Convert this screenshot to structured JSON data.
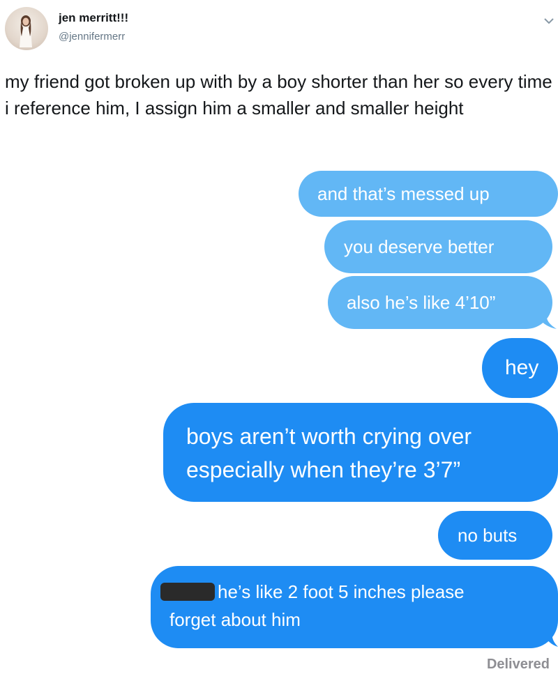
{
  "tweet": {
    "display_name": "jen merritt!!!",
    "handle": "@jennifermerr",
    "text": "my friend got broken up with by a boy shorter than her so every time i reference him, I assign him a smaller and smaller height"
  },
  "messages": [
    {
      "text": "and that’s messed up",
      "style": "light"
    },
    {
      "text": "you deserve better",
      "style": "light"
    },
    {
      "text": "also he’s like 4’10”",
      "style": "light"
    },
    {
      "text": "hey",
      "style": "dark"
    },
    {
      "lines": [
        "boys aren’t worth crying over",
        "especially when they’re 3’7”"
      ],
      "style": "dark"
    },
    {
      "text": "no buts",
      "style": "dark"
    },
    {
      "lines": [
        "he’s like 2 foot 5 inches please",
        "forget about him"
      ],
      "style": "dark",
      "redacted_prefix": true
    }
  ],
  "status": "Delivered",
  "colors": {
    "light_bubble": "#62b7f5",
    "dark_bubble": "#1e8cf3",
    "text": "#14171a",
    "handle": "#657786"
  },
  "icons": [
    "chevron-down-icon"
  ]
}
